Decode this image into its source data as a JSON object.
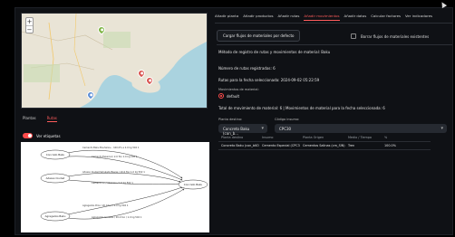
{
  "colors": {
    "accent": "#ff4b4b",
    "background": "#0f1115",
    "marker_green": "#7cb342",
    "marker_red": "#d9534f",
    "marker_blue": "#5b8dd6"
  },
  "map": {
    "zoom_in": "+",
    "zoom_out": "−",
    "markers": [
      "marker-green",
      "marker-red",
      "marker-red-2",
      "marker-blue"
    ]
  },
  "left_tabs": [
    {
      "label": "Plantas"
    },
    {
      "label": "Rutas",
      "active": true
    }
  ],
  "toggle_label": "Ver etiquetas",
  "graph": {
    "nodes": {
      "a": "Concreto Baku",
      "b": "Adesso Ciudad",
      "c": "Agregados Baku",
      "dest": "Concreto Baku"
    },
    "edge_labels": [
      "Cemento Baku Bouharev... 100.0% a 2.0 kg 502 1",
      "Cemento Especial / 2.0 Ton 1.0 kg 202 1",
      "Adesso Ciudad Simulado Bayas / 10.0 Ton 1.0 kg 502 1",
      "Cemento sc / 10.0 ton / 1.0 kg 502 1",
      "Agregados Pros / 20.0 ton / 1.0 kg 502 1",
      "Agregados Gruesos / 20.0 ton / 1.0 kg 502 1"
    ]
  },
  "tabs": [
    {
      "label": "Añadir planta"
    },
    {
      "label": "Añadir productos"
    },
    {
      "label": "Añadir rutas"
    },
    {
      "label": "Añadir movimientos",
      "active": true
    },
    {
      "label": "Añadir datos"
    },
    {
      "label": "Calcular factores"
    },
    {
      "label": "Ver indicadores"
    }
  ],
  "actions": {
    "load_default": "Cargar flujos de materiales por defecto",
    "clear_existing": "Borrar flujos de materiales existentes"
  },
  "main": {
    "method_text": "Método de registro de rutas y movimientos de material: Baku",
    "routes_count": "Número de rutas registradas: 6",
    "routes_date": "Rutas para la fecha seleccionada: 2024-09-02 05:22:59",
    "movement_label": "Movimientos de material:",
    "radio_option": "default",
    "total_text": "Total de movimiento de material: 6 | Movimientos de material para la fecha seleccionada: 6",
    "dest_label": "Planta destino:",
    "dest_value": "Concreto Baku (con_b...",
    "code_label": "Código insumo:",
    "code_value": "CPC30"
  },
  "table": {
    "headers": [
      "Planta destino",
      "Insumo",
      "Planta Origen",
      "Medio / Tiempo",
      "%"
    ],
    "rows": [
      [
        "Concreto Baku (con_bKO)",
        "Cemento Especial (CPC30)",
        "Cementos Salinas (cm_SIN)",
        "Tren",
        "100.0%"
      ]
    ]
  }
}
